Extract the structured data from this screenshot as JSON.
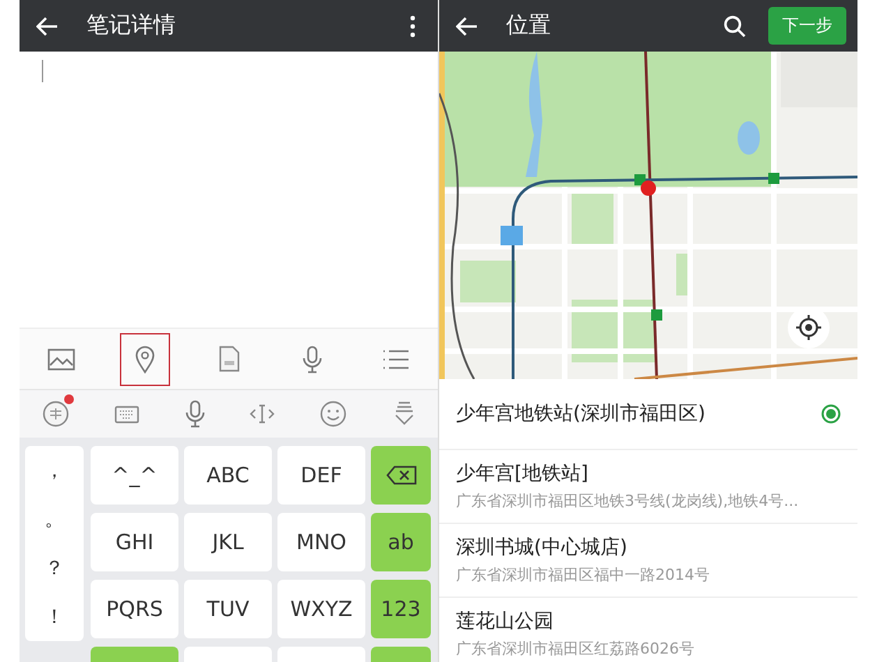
{
  "note_screen": {
    "header": {
      "title": "笔记详情"
    },
    "toolbar": [
      {
        "kind": "image",
        "selected": false
      },
      {
        "kind": "location",
        "selected": true
      },
      {
        "kind": "file",
        "selected": false
      },
      {
        "kind": "mic",
        "selected": false
      },
      {
        "kind": "list",
        "selected": false
      }
    ],
    "keyboard_toolbar": [
      {
        "kind": "ime",
        "badge": true
      },
      {
        "kind": "keyboard"
      },
      {
        "kind": "mic"
      },
      {
        "kind": "cursor"
      },
      {
        "kind": "emoji"
      },
      {
        "kind": "hide"
      }
    ],
    "punctuation": [
      "，",
      "。",
      "？",
      "！"
    ],
    "keys": [
      [
        "^_^",
        "ABC",
        "DEF"
      ],
      [
        "GHI",
        "JKL",
        "MNO"
      ],
      [
        "PQRS",
        "TUV",
        "WXYZ"
      ]
    ],
    "side_keys": [
      {
        "kind": "backspace"
      },
      {
        "kind": "text",
        "label": "ab"
      },
      {
        "kind": "text",
        "label": "123"
      }
    ]
  },
  "location_screen": {
    "header": {
      "title": "位置",
      "next_button": "下一步"
    },
    "places": [
      {
        "name": "少年宫地铁站(深圳市福田区)",
        "selected": true
      },
      {
        "name": "少年宫[地铁站]",
        "address": "广东省深圳市福田区地铁3号线(龙岗线),地铁4号...",
        "selected": false
      },
      {
        "name": "深圳书城(中心城店)",
        "address": "广东省深圳市福田区福中一路2014号",
        "selected": false
      },
      {
        "name": "莲花山公园",
        "address": "广东省深圳市福田区红荔路6026号",
        "selected": false
      }
    ]
  }
}
